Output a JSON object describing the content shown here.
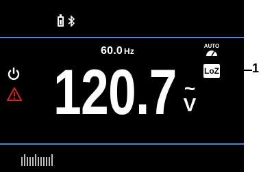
{
  "status_bar": {
    "battery_icon": "battery-icon",
    "bluetooth_icon": "bluetooth-icon"
  },
  "frequency": {
    "value": "60.0",
    "unit": "Hz"
  },
  "reading": {
    "value": "120.7",
    "unit_symbol": "~",
    "unit": "V"
  },
  "indicators": {
    "auto_label": "AUTO",
    "loz_label": "LoZ",
    "power_icon": "power-icon",
    "warning_icon": "warning-triangle-icon"
  },
  "bargraph_icon": "bargraph-icon",
  "callout": {
    "number": "1"
  },
  "colors": {
    "screen_bg": "#000000",
    "divider": "#4a86d6",
    "warning": "#e0201b",
    "text": "#ffffff"
  }
}
